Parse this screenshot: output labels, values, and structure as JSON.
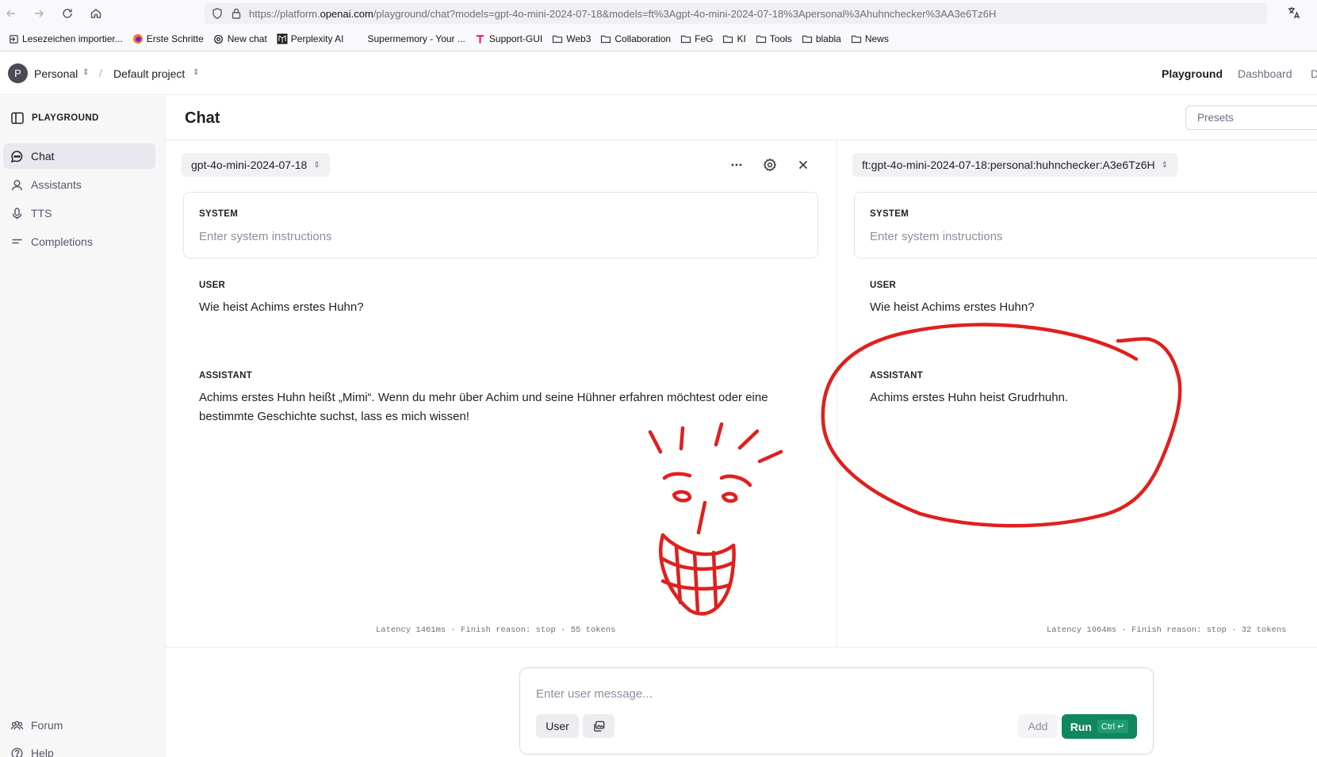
{
  "browser": {
    "url_prefix": "https://platform.",
    "url_domain": "openai.com",
    "url_rest": "/playground/chat?models=gpt-4o-mini-2024-07-18&models=ft%3Agpt-4o-mini-2024-07-18%3Apersonal%3Ahuhnchecker%3AA3e6Tz6H",
    "bookmarks": [
      {
        "label": "Lesezeichen importier...",
        "icon": "import-icon"
      },
      {
        "label": "Erste Schritte",
        "icon": "firefox-icon"
      },
      {
        "label": "New chat",
        "icon": "openai-icon"
      },
      {
        "label": "Perplexity AI",
        "icon": "perplexity-icon"
      },
      {
        "label": "Supermemory - Your ...",
        "icon": "blank-icon"
      },
      {
        "label": "Support-GUI",
        "icon": "telekom-icon"
      },
      {
        "label": "Web3",
        "icon": "folder-icon"
      },
      {
        "label": "Collaboration",
        "icon": "folder-icon"
      },
      {
        "label": "FeG",
        "icon": "folder-icon"
      },
      {
        "label": "KI",
        "icon": "folder-icon"
      },
      {
        "label": "Tools",
        "icon": "folder-icon"
      },
      {
        "label": "blabla",
        "icon": "folder-icon"
      },
      {
        "label": "News",
        "icon": "folder-icon"
      }
    ],
    "accent_telekom": "#e20074"
  },
  "header": {
    "org_initial": "P",
    "org_name": "Personal",
    "separator": "/",
    "project_name": "Default project",
    "nav": {
      "playground": "Playground",
      "dashboard": "Dashboard",
      "docs": "D"
    }
  },
  "sidebar": {
    "title": "PLAYGROUND",
    "items": [
      {
        "label": "Chat",
        "icon": "chat-bubble-icon",
        "active": true
      },
      {
        "label": "Assistants",
        "icon": "assistants-icon"
      },
      {
        "label": "TTS",
        "icon": "microphone-icon"
      },
      {
        "label": "Completions",
        "icon": "completions-icon"
      }
    ],
    "footer": [
      {
        "label": "Forum",
        "icon": "users-icon"
      },
      {
        "label": "Help",
        "icon": "help-icon"
      }
    ]
  },
  "main": {
    "title": "Chat",
    "presets_placeholder": "Presets"
  },
  "panels": [
    {
      "model": "gpt-4o-mini-2024-07-18",
      "system_label": "SYSTEM",
      "system_placeholder": "Enter system instructions",
      "user_label": "USER",
      "user_message": "Wie heist Achims erstes Huhn?",
      "assistant_label": "ASSISTANT",
      "assistant_message": "Achims erstes Huhn heißt „Mimi“. Wenn du mehr über Achim und seine Hühner erfahren möchtest oder eine bestimmte Geschichte suchst, lass es mich wissen!",
      "meta": "Latency 1461ms · Finish reason: stop · 55 tokens"
    },
    {
      "model": "ft:gpt-4o-mini-2024-07-18:personal:huhnchecker:A3e6Tz6H",
      "system_label": "SYSTEM",
      "system_placeholder": "Enter system instructions",
      "user_label": "USER",
      "user_message": "Wie heist Achims erstes Huhn?",
      "assistant_label": "ASSISTANT",
      "assistant_message": "Achims erstes Huhn heist Grudrhuhn.",
      "meta": "Latency 1064ms · Finish reason: stop · 32 tokens"
    }
  ],
  "composer": {
    "placeholder": "Enter user message...",
    "role": "User",
    "add": "Add",
    "run": "Run",
    "run_shortcut": "Ctrl ↵"
  },
  "colors": {
    "run_button": "#10875f",
    "annotation_red": "#e0201e"
  }
}
